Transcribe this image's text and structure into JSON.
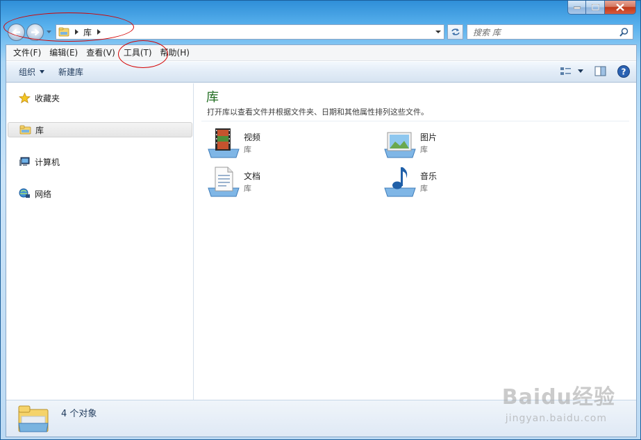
{
  "address": {
    "crumb": "库",
    "search_placeholder": "搜索 库"
  },
  "menu": [
    "文件(F)",
    "编辑(E)",
    "查看(V)",
    "工具(T)",
    "帮助(H)"
  ],
  "toolbar": {
    "organize_label": "组织",
    "new_library_label": "新建库"
  },
  "nav": {
    "favorites": "收藏夹",
    "libraries": "库",
    "computer": "计算机",
    "network": "网络"
  },
  "main": {
    "title": "库",
    "subtitle": "打开库以查看文件并根据文件夹、日期和其他属性排列这些文件。",
    "tiles": [
      {
        "name": "视频",
        "type": "库",
        "icon": "video-library-icon"
      },
      {
        "name": "图片",
        "type": "库",
        "icon": "pictures-library-icon"
      },
      {
        "name": "文档",
        "type": "库",
        "icon": "documents-library-icon"
      },
      {
        "name": "音乐",
        "type": "库",
        "icon": "music-library-icon"
      }
    ]
  },
  "details": {
    "count_text": "4 个对象"
  },
  "watermark": {
    "main": "Baidu经验",
    "sub": "jingyan.baidu.com"
  },
  "colors": {
    "title_green": "#1e6b1e",
    "annotation_red": "#d40000",
    "window_blue": "#2f8fd8"
  }
}
